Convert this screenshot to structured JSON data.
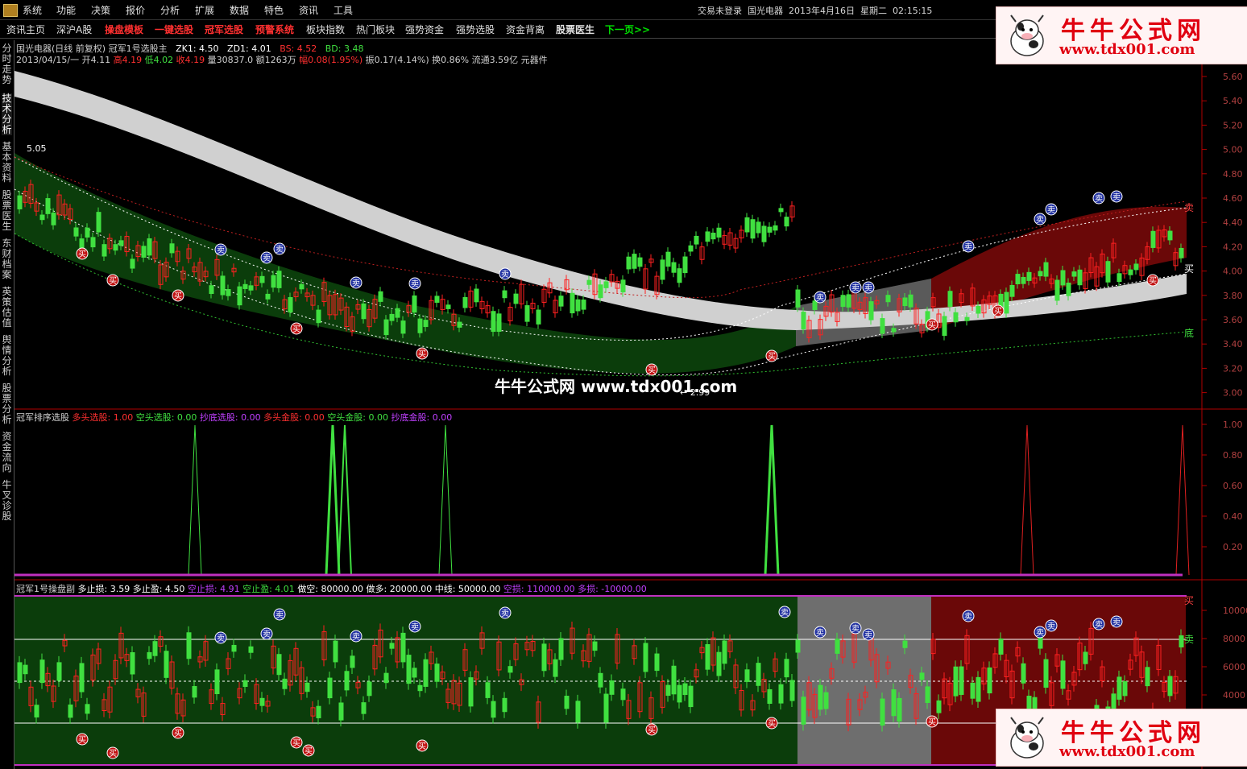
{
  "menu": [
    "系统",
    "功能",
    "决策",
    "报价",
    "分析",
    "扩展",
    "数据",
    "特色",
    "资讯",
    "工具"
  ],
  "status_bar": {
    "login": "交易未登录",
    "stock": "国光电器",
    "date": "2013年4月16日",
    "weekday": "星期二",
    "time": "02:15:15"
  },
  "toolbar": [
    "资讯主页",
    "深沪A股",
    "操盘模板",
    "一键选股",
    "冠军选股",
    "预警系统",
    "板块指数",
    "热门板块",
    "强势资金",
    "强势选股",
    "资金背离",
    "股票医生",
    "下一页>>"
  ],
  "sidebar": [
    "分时走势",
    "技术分析",
    "基本资料",
    "股票医生",
    "东财档案",
    "英策估值",
    "舆情分析",
    "股票分析",
    "资金流向",
    "牛叉诊股"
  ],
  "main_panel": {
    "title": "国光电器(日线 前复权) 冠军1号选股主",
    "zk1": "ZK1: 4.50",
    "zd1": "ZD1: 4.01",
    "bs": "BS: 4.52",
    "bd": "BD: 3.48",
    "ohlc": {
      "date": "2013/04/15/一",
      "open": "开4.11",
      "high": "高4.19",
      "low": "低4.02",
      "close": "收4.19",
      "vol": "量30837.0",
      "amount": "额1263万",
      "change": "幅0.08(1.95%)",
      "amplitude": "振0.17(4.14%)",
      "turnover": "换0.86%",
      "float": "流通3.59亿 元器件"
    },
    "y_ticks": [
      "5.60",
      "5.40",
      "5.20",
      "5.00",
      "4.80",
      "4.60",
      "4.40",
      "4.20",
      "4.00",
      "3.80",
      "3.60",
      "3.40",
      "3.20",
      "3.00"
    ],
    "max_label": "5.05",
    "min_label": "← 2.99",
    "right_labels": {
      "sell": "卖",
      "buy": "买",
      "bottom": "底"
    }
  },
  "rank_panel": {
    "title": "冠军排序选股",
    "items": [
      "多头选股: 1.00",
      "空头选股: 0.00",
      "抄底选股: 0.00",
      "多头金股: 0.00",
      "空头金股: 0.00",
      "抄底金股: 0.00"
    ],
    "y_ticks": [
      "1.00",
      "0.80",
      "0.60",
      "0.40",
      "0.20"
    ]
  },
  "sub_panel": {
    "title": "冠军1号操盘副",
    "items": [
      "多止损: 3.59",
      "多止盈: 4.50",
      "空止损: 4.91",
      "空止盈: 4.01",
      "做空: 80000.00",
      "做多: 20000.00",
      "中线: 50000.00",
      "空损: 110000.00",
      "多损: -10000.00"
    ],
    "y_ticks": [
      "10000",
      "8000",
      "6000",
      "4000"
    ],
    "right_labels": {
      "sell": "卖",
      "buy": "买"
    }
  },
  "signals": {
    "buy": "买",
    "sell": "卖"
  },
  "watermark": {
    "title": "牛牛公式网",
    "url": "www.tdx001.com"
  },
  "center_watermark": "牛牛公式网 www.tdx001.com",
  "colors": {
    "up": "#ff2020",
    "down": "#40e040",
    "green_band": "#0b3d0b",
    "red_band": "#6a0808",
    "gray_band": "#6e6e6e",
    "magenta": "#ff40ff",
    "axis": "#b00000"
  }
}
